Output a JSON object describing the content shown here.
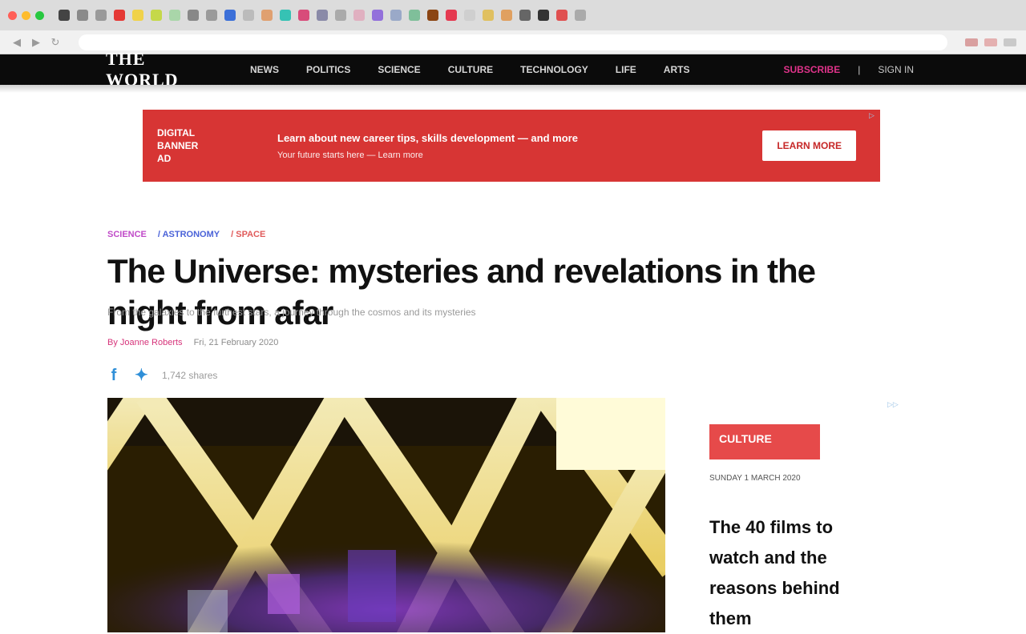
{
  "browser": {
    "traffic_colors": [
      "#ff5f57",
      "#febc2e",
      "#28c840"
    ],
    "favicon_colors": [
      "#444444",
      "#8a8a8a",
      "#999999",
      "#e53935",
      "#f0d24a",
      "#c5d84a",
      "#a9d6a9",
      "#888888",
      "#9a9a9a",
      "#3b6fd8",
      "#bbbbbb",
      "#e0a070",
      "#36c2b4",
      "#d84c7a",
      "#8a8aa8",
      "#aaaaaa",
      "#e0b0c0",
      "#9370db",
      "#9aa9c8",
      "#7fbf9a",
      "#8b4513",
      "#e53950",
      "#cfcfcf",
      "#e0c060",
      "#e0a060",
      "#666666",
      "#333333",
      "#e05050",
      "#aaaaaa"
    ],
    "url": ""
  },
  "site": {
    "logo": "THE WORLD",
    "nav_items": [
      "NEWS",
      "POLITICS",
      "SCIENCE",
      "CULTURE",
      "TECHNOLOGY",
      "LIFE",
      "ARTS"
    ],
    "nav_right": [
      "SUBSCRIBE",
      "|",
      "SIGN IN"
    ]
  },
  "ad": {
    "brand": [
      "DIGITAL",
      "BANNER",
      "AD"
    ],
    "headline": "Learn about new career tips, skills development — and more",
    "subline": "Your future starts here — Learn more",
    "cta": "LEARN MORE",
    "choice_icon": "adchoices-icon",
    "color": "#d73534"
  },
  "article": {
    "breadcrumb": [
      {
        "label": "SCIENCE",
        "color": "#c04ac8"
      },
      {
        "label": "/ ASTRONOMY",
        "color": "#4a62d8"
      },
      {
        "label": "/ SPACE",
        "color": "#e05a5a"
      }
    ],
    "headline": "The Universe: mysteries and revelations in the night from afar",
    "standfirst": "From the galaxies to the furthest stars, a journey through the cosmos and its mysteries",
    "author": "By Joanne Roberts",
    "date": "Fri, 21 February 2020",
    "share_count": "1,742 shares",
    "share_icons": [
      "facebook-icon",
      "twitter-icon"
    ]
  },
  "sidebar": {
    "label": "CULTURE",
    "date": "SUNDAY 1 MARCH 2020",
    "headline": "The 40 films to watch and the reasons behind them"
  }
}
